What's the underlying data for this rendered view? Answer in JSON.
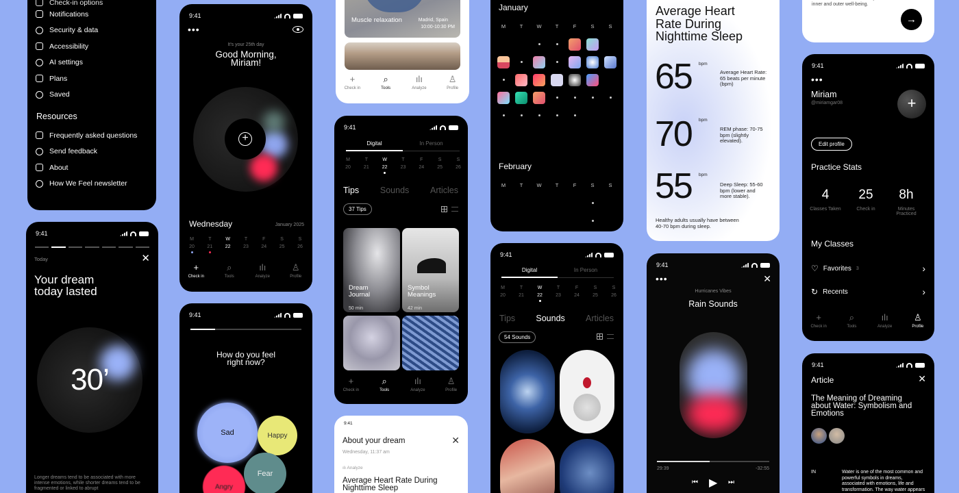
{
  "colors": {
    "background": "#93adf4",
    "accent_blue": "#8fa5ee",
    "accent_red": "#ff2b55",
    "accent_yellow": "#e8e877",
    "accent_teal": "#5f8c8c"
  },
  "status_time": "9:41",
  "settings": {
    "top_item": "Check-in options",
    "items": [
      {
        "label": "Notifications",
        "icon": "bell-icon"
      },
      {
        "label": "Security & data",
        "icon": "shield-icon"
      },
      {
        "label": "Accessibility",
        "icon": "accessibility-icon"
      },
      {
        "label": "AI settings",
        "icon": "eye-icon"
      },
      {
        "label": "Plans",
        "icon": "trophy-icon"
      },
      {
        "label": "Saved",
        "icon": "bookmark-icon"
      }
    ],
    "resources_heading": "Resources",
    "resources": [
      {
        "label": "Frequently asked questions",
        "icon": "help-icon"
      },
      {
        "label": "Send feedback",
        "icon": "send-icon"
      },
      {
        "label": "About",
        "icon": "info-icon"
      },
      {
        "label": "How We Feel newsletter",
        "icon": "newsletter-icon"
      }
    ]
  },
  "morning": {
    "day_note": "It's your 25th day",
    "greeting": "Good Morning, Miriam!",
    "weekday": "Wednesday",
    "month": "January 2025"
  },
  "week": {
    "letters": [
      "M",
      "T",
      "W",
      "T",
      "F",
      "S",
      "S"
    ],
    "numbers": [
      "20",
      "21",
      "22",
      "23",
      "24",
      "25",
      "26"
    ]
  },
  "tabs_main": [
    "Check in",
    "Tools",
    "Analyze",
    "Profile"
  ],
  "dream": {
    "today": "Today",
    "title": "Your dream today lasted",
    "duration": "30’",
    "text": "Longer dreams tend to be associated with more intense emotions, while shorter dreams tend to be fragmented or linked to abrupt"
  },
  "feel": {
    "question": "How do you feel right now?",
    "emotions": [
      "Sad",
      "Happy",
      "Fear",
      "Angry"
    ]
  },
  "relax": {
    "title": "Muscle relaxation",
    "location": "Madrid, Spain",
    "time": "10:00-10:30 PM"
  },
  "tools": {
    "seg": [
      "Digital",
      "In Person"
    ],
    "tabs": [
      "Tips",
      "Sounds",
      "Articles"
    ],
    "count": "37 Tips",
    "tiles": [
      {
        "title": "Dream Journal",
        "dur": "50 min"
      },
      {
        "title": "Symbol Meanings",
        "dur": "42 min"
      }
    ]
  },
  "about_dream": {
    "title": "About your dream",
    "date": "Wednesday, 11:37 am",
    "analyze": "Analyze",
    "headline": "Average Heart Rate During Nighttime Sleep"
  },
  "calendar": {
    "jan": "January",
    "feb": "February"
  },
  "sounds": {
    "count": "54 Sounds"
  },
  "heart": {
    "title": "Average Heart Rate During Nighttime Sleep",
    "unit": "bpm",
    "values": [
      {
        "v": "65",
        "note": "Average Heart Rate: 65 beats per minute (bpm)"
      },
      {
        "v": "70",
        "note": "REM phase: 70-75 bpm (slightly elevated)."
      },
      {
        "v": "55",
        "note": "Deep Sleep: 55-60 bpm (lower and more stable)."
      }
    ],
    "footer": "Healthy adults usually have between 40-70 bpm during sleep."
  },
  "player": {
    "playlist": "Hurricanes Vibes",
    "track": "Rain Sounds",
    "elapsed": "29:39",
    "remaining": "-32:55",
    "progress": 0.47
  },
  "promo": {
    "text": "connect with tools to nurture your inner and outer well-being."
  },
  "profile": {
    "name": "Miriam",
    "handle": "@miriamgar08",
    "edit": "Edit profile",
    "stats_title": "Practice Stats",
    "stats": [
      {
        "v": "4",
        "l": "Classes Taken"
      },
      {
        "v": "25",
        "l": "Check in"
      },
      {
        "v": "8h",
        "l": "Minutes Practiced"
      }
    ],
    "classes_title": "My Classes",
    "favorites": "Favorites",
    "favorites_count": "3",
    "recents": "Recents"
  },
  "article": {
    "label": "Article",
    "title": "The Meaning of Dreaming about Water: Symbolism and Emotions",
    "in": "IN",
    "body": "Water is one of the most common and powerful symbols in dreams, associated with emotions, life and transformation. The way water appears"
  }
}
